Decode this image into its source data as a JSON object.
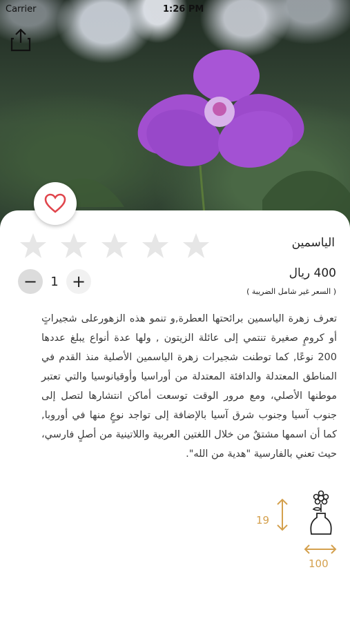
{
  "status_bar": {
    "carrier": "Carrier",
    "time": "1:26 PM"
  },
  "product": {
    "name": "الياسمين",
    "price": "400 ريال",
    "price_note": "( السعر غير شامل الضريبة )",
    "description": "تعرف زهرة الياسمين برائحتها العطرة,و تنمو هذه الزهورعلى شجيراتٍ أو كرومٍ صغيرة تنتمي إلى عائلة الزيتون , ولها عدة أنواع يبلغ عددها 200 نوعًا, كما توطنت شجيرات زهرة الياسمين الأصلية منذ القدم في المناطق المعتدلة والدافئة المعتدلة من أوراسيا وأوقيانوسيا والتي تعتبر موطنها الأصلي، ومع مرور الوقت توسعت أماكن انتشارها لتصل إلى جنوب آسيا وجنوب شرق آسيا بالإضافة إلى تواجد نوعٍ منها في أوروبا, كما أن اسمها مشتقٌ من خلال اللغتين العربية واللاتينية من أصلٍ فارسي، حيث تعني بالفارسية \"هدية من الله\".",
    "rating": 0,
    "rating_max": 5
  },
  "quantity": {
    "value": "1",
    "minus": "−",
    "plus": "+"
  },
  "dimensions": {
    "height": "19",
    "width": "100"
  },
  "icons": {
    "share": "share-icon",
    "favorite": "heart-icon",
    "star": "star-icon",
    "vase": "vase-icon"
  },
  "colors": {
    "accent": "#d4a04d",
    "heart": "#e0454c",
    "star_empty": "#e6e6e6"
  }
}
